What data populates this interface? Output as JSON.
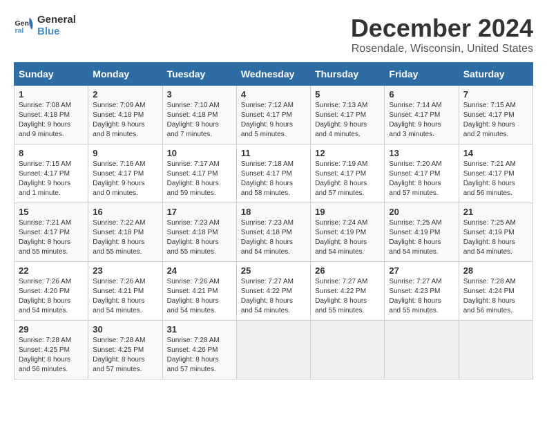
{
  "header": {
    "logo_line1": "General",
    "logo_line2": "Blue",
    "title": "December 2024",
    "subtitle": "Rosendale, Wisconsin, United States"
  },
  "weekdays": [
    "Sunday",
    "Monday",
    "Tuesday",
    "Wednesday",
    "Thursday",
    "Friday",
    "Saturday"
  ],
  "weeks": [
    [
      {
        "day": "1",
        "info": "Sunrise: 7:08 AM\nSunset: 4:18 PM\nDaylight: 9 hours\nand 9 minutes."
      },
      {
        "day": "2",
        "info": "Sunrise: 7:09 AM\nSunset: 4:18 PM\nDaylight: 9 hours\nand 8 minutes."
      },
      {
        "day": "3",
        "info": "Sunrise: 7:10 AM\nSunset: 4:18 PM\nDaylight: 9 hours\nand 7 minutes."
      },
      {
        "day": "4",
        "info": "Sunrise: 7:12 AM\nSunset: 4:17 PM\nDaylight: 9 hours\nand 5 minutes."
      },
      {
        "day": "5",
        "info": "Sunrise: 7:13 AM\nSunset: 4:17 PM\nDaylight: 9 hours\nand 4 minutes."
      },
      {
        "day": "6",
        "info": "Sunrise: 7:14 AM\nSunset: 4:17 PM\nDaylight: 9 hours\nand 3 minutes."
      },
      {
        "day": "7",
        "info": "Sunrise: 7:15 AM\nSunset: 4:17 PM\nDaylight: 9 hours\nand 2 minutes."
      }
    ],
    [
      {
        "day": "8",
        "info": "Sunrise: 7:15 AM\nSunset: 4:17 PM\nDaylight: 9 hours\nand 1 minute."
      },
      {
        "day": "9",
        "info": "Sunrise: 7:16 AM\nSunset: 4:17 PM\nDaylight: 9 hours\nand 0 minutes."
      },
      {
        "day": "10",
        "info": "Sunrise: 7:17 AM\nSunset: 4:17 PM\nDaylight: 8 hours\nand 59 minutes."
      },
      {
        "day": "11",
        "info": "Sunrise: 7:18 AM\nSunset: 4:17 PM\nDaylight: 8 hours\nand 58 minutes."
      },
      {
        "day": "12",
        "info": "Sunrise: 7:19 AM\nSunset: 4:17 PM\nDaylight: 8 hours\nand 57 minutes."
      },
      {
        "day": "13",
        "info": "Sunrise: 7:20 AM\nSunset: 4:17 PM\nDaylight: 8 hours\nand 57 minutes."
      },
      {
        "day": "14",
        "info": "Sunrise: 7:21 AM\nSunset: 4:17 PM\nDaylight: 8 hours\nand 56 minutes."
      }
    ],
    [
      {
        "day": "15",
        "info": "Sunrise: 7:21 AM\nSunset: 4:17 PM\nDaylight: 8 hours\nand 55 minutes."
      },
      {
        "day": "16",
        "info": "Sunrise: 7:22 AM\nSunset: 4:18 PM\nDaylight: 8 hours\nand 55 minutes."
      },
      {
        "day": "17",
        "info": "Sunrise: 7:23 AM\nSunset: 4:18 PM\nDaylight: 8 hours\nand 55 minutes."
      },
      {
        "day": "18",
        "info": "Sunrise: 7:23 AM\nSunset: 4:18 PM\nDaylight: 8 hours\nand 54 minutes."
      },
      {
        "day": "19",
        "info": "Sunrise: 7:24 AM\nSunset: 4:19 PM\nDaylight: 8 hours\nand 54 minutes."
      },
      {
        "day": "20",
        "info": "Sunrise: 7:25 AM\nSunset: 4:19 PM\nDaylight: 8 hours\nand 54 minutes."
      },
      {
        "day": "21",
        "info": "Sunrise: 7:25 AM\nSunset: 4:19 PM\nDaylight: 8 hours\nand 54 minutes."
      }
    ],
    [
      {
        "day": "22",
        "info": "Sunrise: 7:26 AM\nSunset: 4:20 PM\nDaylight: 8 hours\nand 54 minutes."
      },
      {
        "day": "23",
        "info": "Sunrise: 7:26 AM\nSunset: 4:21 PM\nDaylight: 8 hours\nand 54 minutes."
      },
      {
        "day": "24",
        "info": "Sunrise: 7:26 AM\nSunset: 4:21 PM\nDaylight: 8 hours\nand 54 minutes."
      },
      {
        "day": "25",
        "info": "Sunrise: 7:27 AM\nSunset: 4:22 PM\nDaylight: 8 hours\nand 54 minutes."
      },
      {
        "day": "26",
        "info": "Sunrise: 7:27 AM\nSunset: 4:22 PM\nDaylight: 8 hours\nand 55 minutes."
      },
      {
        "day": "27",
        "info": "Sunrise: 7:27 AM\nSunset: 4:23 PM\nDaylight: 8 hours\nand 55 minutes."
      },
      {
        "day": "28",
        "info": "Sunrise: 7:28 AM\nSunset: 4:24 PM\nDaylight: 8 hours\nand 56 minutes."
      }
    ],
    [
      {
        "day": "29",
        "info": "Sunrise: 7:28 AM\nSunset: 4:25 PM\nDaylight: 8 hours\nand 56 minutes."
      },
      {
        "day": "30",
        "info": "Sunrise: 7:28 AM\nSunset: 4:25 PM\nDaylight: 8 hours\nand 57 minutes."
      },
      {
        "day": "31",
        "info": "Sunrise: 7:28 AM\nSunset: 4:26 PM\nDaylight: 8 hours\nand 57 minutes."
      },
      {
        "day": "",
        "info": ""
      },
      {
        "day": "",
        "info": ""
      },
      {
        "day": "",
        "info": ""
      },
      {
        "day": "",
        "info": ""
      }
    ]
  ]
}
